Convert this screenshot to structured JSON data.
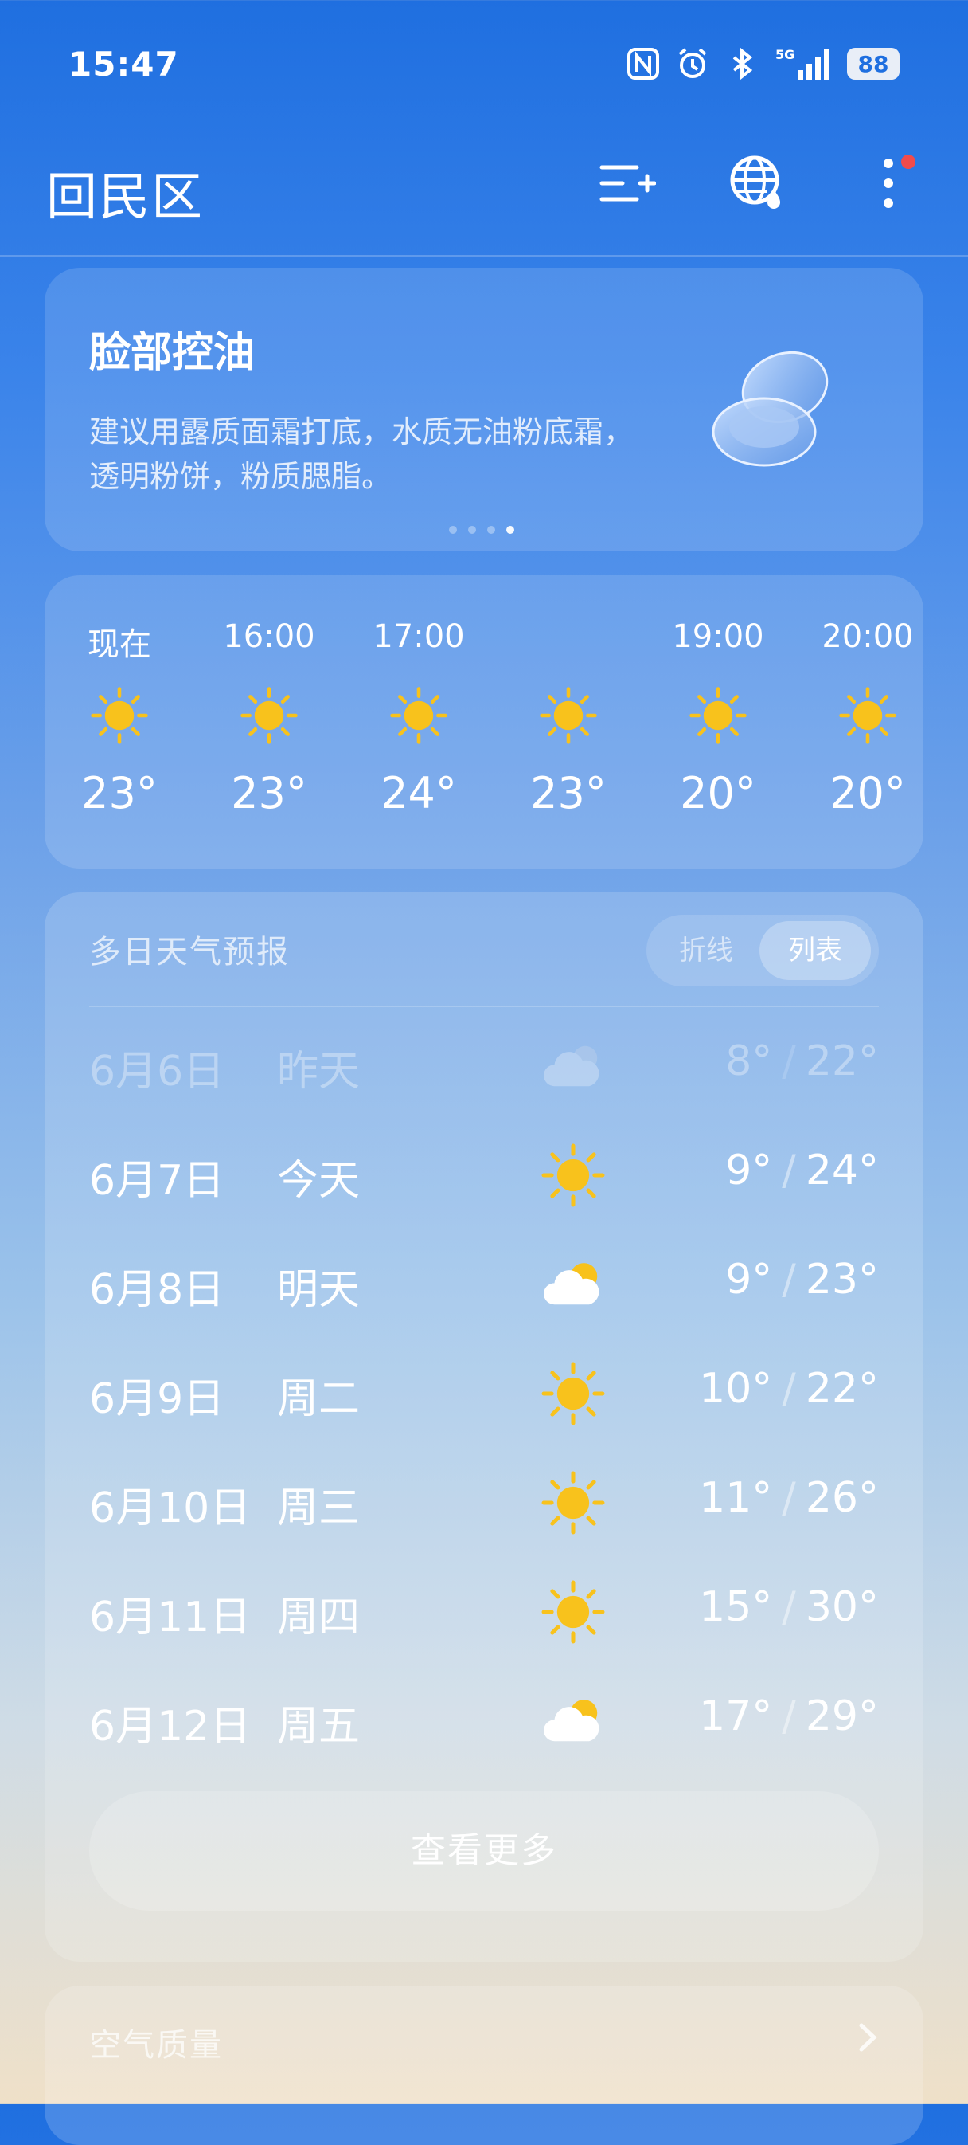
{
  "status_bar": {
    "time": "15:47",
    "icons": [
      "nfc-icon",
      "alarm-icon",
      "bluetooth-icon",
      "signal-5g-icon"
    ],
    "signal_label": "5G",
    "battery": "88"
  },
  "header": {
    "city": "回民区",
    "actions": [
      "city-list-add-icon",
      "globe-weather-icon",
      "more-menu-icon"
    ]
  },
  "tip_card": {
    "title": "脸部控油",
    "text": "建议用露质面霜打底，水质无油粉底霜，透明粉饼，粉质腮脂。",
    "page_count": 4,
    "active_page": 4
  },
  "hourly": [
    {
      "time": "现在",
      "icon": "sun-icon",
      "temp": "23°"
    },
    {
      "time": "16:00",
      "icon": "sun-icon",
      "temp": "23°"
    },
    {
      "time": "17:00",
      "icon": "sun-icon",
      "temp": "24°"
    },
    {
      "time": "",
      "icon": "sun-icon",
      "temp": "23°"
    },
    {
      "time": "19:00",
      "icon": "sun-icon",
      "temp": "20°"
    },
    {
      "time": "20:00",
      "icon": "sun-icon",
      "temp": "20°"
    }
  ],
  "daily": {
    "title": "多日天气预报",
    "toggle": {
      "line": "折线",
      "list": "列表",
      "selected": "列表"
    },
    "rows": [
      {
        "date": "6月6日",
        "day": "昨天",
        "icon": "cloudy-night-icon",
        "low": "8°",
        "high": "22°",
        "past": true
      },
      {
        "date": "6月7日",
        "day": "今天",
        "icon": "sun-icon",
        "low": "9°",
        "high": "24°"
      },
      {
        "date": "6月8日",
        "day": "明天",
        "icon": "partly-cloudy-icon",
        "low": "9°",
        "high": "23°"
      },
      {
        "date": "6月9日",
        "day": "周二",
        "icon": "sun-icon",
        "low": "10°",
        "high": "22°"
      },
      {
        "date": "6月10日",
        "day": "周三",
        "icon": "sun-icon",
        "low": "11°",
        "high": "26°"
      },
      {
        "date": "6月11日",
        "day": "周四",
        "icon": "sun-icon",
        "low": "15°",
        "high": "30°"
      },
      {
        "date": "6月12日",
        "day": "周五",
        "icon": "partly-cloudy-icon",
        "low": "17°",
        "high": "29°"
      }
    ],
    "separator": "/",
    "more_button": "查看更多"
  },
  "air_quality": {
    "title": "空气质量"
  },
  "colors": {
    "sun": "#f8c21c",
    "notification_dot": "#f24b4b"
  }
}
